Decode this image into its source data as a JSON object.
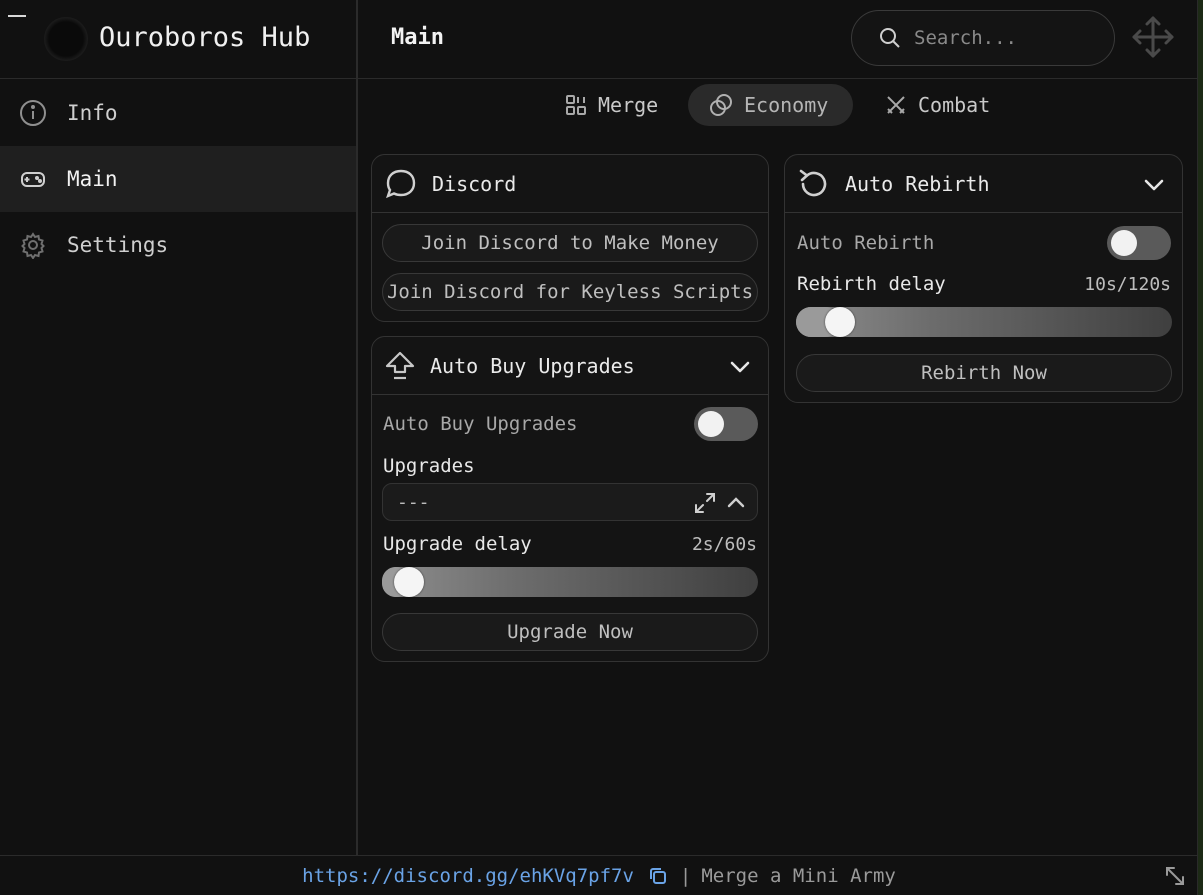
{
  "app": {
    "title": "Ouroboros Hub"
  },
  "header": {
    "page_title": "Main",
    "search_placeholder": "Search..."
  },
  "sidebar": {
    "items": [
      {
        "label": "Info",
        "icon": "info-icon",
        "active": false
      },
      {
        "label": "Main",
        "icon": "gamepad-icon",
        "active": true
      },
      {
        "label": "Settings",
        "icon": "gear-icon",
        "active": false
      }
    ]
  },
  "tabs": [
    {
      "label": "Merge",
      "icon": "merge-icon",
      "active": false
    },
    {
      "label": "Economy",
      "icon": "coins-icon",
      "active": true
    },
    {
      "label": "Combat",
      "icon": "swords-icon",
      "active": false
    }
  ],
  "discord_card": {
    "title": "Discord",
    "buttons": [
      "Join Discord to Make Money",
      "Join Discord for Keyless Scripts"
    ]
  },
  "upgrades_card": {
    "title": "Auto Buy Upgrades",
    "toggle_label": "Auto Buy Upgrades",
    "toggle_on": false,
    "dropdown_label": "Upgrades",
    "dropdown_value": "---",
    "slider_label": "Upgrade delay",
    "slider_value_text": "2s/60s",
    "slider_value": 2,
    "slider_max": 60,
    "button_label": "Upgrade Now"
  },
  "rebirth_card": {
    "title": "Auto Rebirth",
    "toggle_label": "Auto Rebirth",
    "toggle_on": false,
    "slider_label": "Rebirth delay",
    "slider_value_text": "10s/120s",
    "slider_value": 10,
    "slider_max": 120,
    "button_label": "Rebirth Now"
  },
  "footer": {
    "link": "https://discord.gg/ehKVq7pf7v",
    "separator": "|",
    "game_name": "Merge a Mini Army"
  }
}
